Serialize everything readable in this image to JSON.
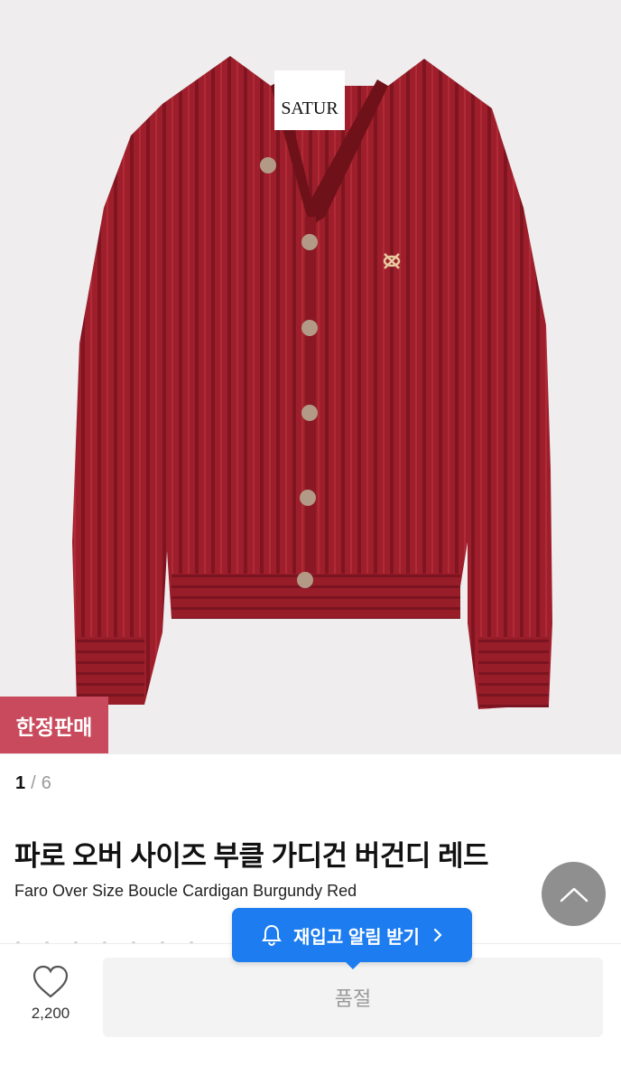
{
  "product": {
    "badge": "한정판매",
    "brand_label": "SATUR",
    "image_counter": {
      "current": "1",
      "separator": "/",
      "total": "6"
    },
    "title_ko": "파로 오버 사이즈 부클 가디건 버건디 레드",
    "title_en": "Faro Over Size Boucle Cardigan Burgundy Red"
  },
  "actions": {
    "restock_label": "재입고 알림 받기",
    "soldout_label": "품절",
    "wish_count": "2,200"
  },
  "colors": {
    "badge": "#c94a5c",
    "restock": "#1c7cf0",
    "cardigan": "#9e1f2b"
  },
  "icons": [
    "heart-icon",
    "bell-icon",
    "chevron-right-icon",
    "chevron-up-icon"
  ]
}
